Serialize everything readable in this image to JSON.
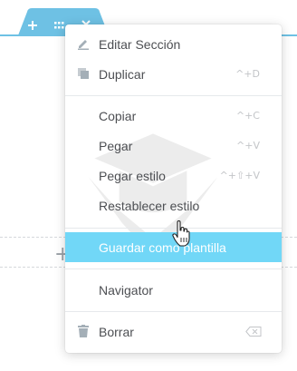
{
  "section_toolbar": {
    "add_icon": "plus-icon",
    "drag_icon": "grid-handle-icon",
    "close_icon": "close-icon",
    "accent_color": "#6ec1e4"
  },
  "context_menu": {
    "active_color": "#71d7f7",
    "groups": [
      {
        "items": [
          {
            "label": "Editar Sección",
            "icon": "pencil-icon",
            "shortcut": ""
          },
          {
            "label": "Duplicar",
            "icon": "copy-icon",
            "shortcut": "^+D"
          }
        ]
      },
      {
        "items": [
          {
            "label": "Copiar",
            "shortcut": "^+C"
          },
          {
            "label": "Pegar",
            "shortcut": "^+V"
          },
          {
            "label": "Pegar estilo",
            "shortcut": "^+⇧+V"
          },
          {
            "label": "Restablecer estilo",
            "shortcut": ""
          }
        ]
      },
      {
        "items": [
          {
            "label": "Guardar como plantilla",
            "state": "hovered"
          }
        ]
      },
      {
        "items": [
          {
            "label": "Navigator"
          }
        ]
      },
      {
        "items": [
          {
            "label": "Borrar",
            "icon": "trash-icon",
            "shortcut_icon": "delete-key-icon"
          }
        ]
      }
    ]
  }
}
